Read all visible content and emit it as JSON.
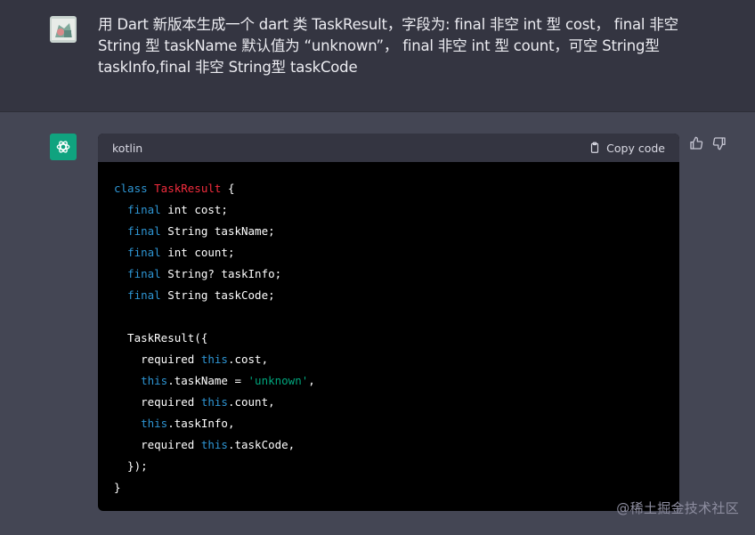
{
  "user_message": {
    "text": "用 Dart 新版本生成一个 dart 类 TaskResult，字段为: final 非空 int 型 cost， final 非空 String 型 taskName 默认值为 “unknown”， final 非空 int 型 count，可空 String型 taskInfo,final 非空 String型 taskCode"
  },
  "assistant_avatar_icon": "openai-logo-icon",
  "code_block": {
    "language": "kotlin",
    "copy_label": "Copy code",
    "lines": [
      [
        {
          "t": "kw",
          "v": "class "
        },
        {
          "t": "cls",
          "v": "TaskResult"
        },
        {
          "t": "",
          "v": " {"
        }
      ],
      [
        {
          "t": "",
          "v": "  "
        },
        {
          "t": "kw",
          "v": "final"
        },
        {
          "t": "",
          "v": " int cost;"
        }
      ],
      [
        {
          "t": "",
          "v": "  "
        },
        {
          "t": "kw",
          "v": "final"
        },
        {
          "t": "",
          "v": " String taskName;"
        }
      ],
      [
        {
          "t": "",
          "v": "  "
        },
        {
          "t": "kw",
          "v": "final"
        },
        {
          "t": "",
          "v": " int count;"
        }
      ],
      [
        {
          "t": "",
          "v": "  "
        },
        {
          "t": "kw",
          "v": "final"
        },
        {
          "t": "",
          "v": " String? taskInfo;"
        }
      ],
      [
        {
          "t": "",
          "v": "  "
        },
        {
          "t": "kw",
          "v": "final"
        },
        {
          "t": "",
          "v": " String taskCode;"
        }
      ],
      [
        {
          "t": "",
          "v": ""
        }
      ],
      [
        {
          "t": "",
          "v": "  TaskResult({"
        }
      ],
      [
        {
          "t": "",
          "v": "    required "
        },
        {
          "t": "kw",
          "v": "this"
        },
        {
          "t": "",
          "v": ".cost,"
        }
      ],
      [
        {
          "t": "",
          "v": "    "
        },
        {
          "t": "kw",
          "v": "this"
        },
        {
          "t": "",
          "v": ".taskName = "
        },
        {
          "t": "str",
          "v": "'unknown'"
        },
        {
          "t": "",
          "v": ","
        }
      ],
      [
        {
          "t": "",
          "v": "    required "
        },
        {
          "t": "kw",
          "v": "this"
        },
        {
          "t": "",
          "v": ".count,"
        }
      ],
      [
        {
          "t": "",
          "v": "    "
        },
        {
          "t": "kw",
          "v": "this"
        },
        {
          "t": "",
          "v": ".taskInfo,"
        }
      ],
      [
        {
          "t": "",
          "v": "    required "
        },
        {
          "t": "kw",
          "v": "this"
        },
        {
          "t": "",
          "v": ".taskCode,"
        }
      ],
      [
        {
          "t": "",
          "v": "  });"
        }
      ],
      [
        {
          "t": "",
          "v": "}"
        }
      ]
    ]
  },
  "feedback": {
    "thumbs_up_icon": "thumbs-up-icon",
    "thumbs_down_icon": "thumbs-down-icon"
  },
  "watermark": "@稀土掘金技术社区",
  "colors": {
    "page_bg": "#444654",
    "user_bg": "#343541",
    "code_bg": "#000000",
    "keyword": "#2e95d3",
    "class_name": "#f22c3d",
    "string": "#00a67d",
    "accent": "#10a37f"
  }
}
